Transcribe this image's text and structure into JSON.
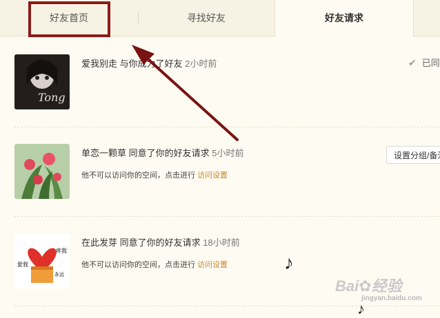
{
  "tabs": {
    "home": "好友首页",
    "find": "寻找好友",
    "requests": "好友请求"
  },
  "requests": [
    {
      "name": "爱我别走",
      "action": "与你成为了好友",
      "time": "2小时前",
      "status": "已同"
    },
    {
      "name": "单恋一颗草",
      "action": "同意了你的好友请求",
      "time": "5小时前",
      "note": "他不可以访问你的空间，点击进行",
      "link": "访问设置",
      "button": "设置分组/备注"
    },
    {
      "name": "在此发芽",
      "action": "同意了你的好友请求",
      "time": "18小时前",
      "note": "他不可以访问你的空间，点击进行",
      "link": "访问设置"
    }
  ],
  "watermark": {
    "brand": "Bai",
    "brand2": "经验",
    "url": "jingyan.baidu.com"
  },
  "colors": {
    "highlight": "#8b1a1a",
    "link": "#c8892e",
    "background": "#fdfbf2"
  }
}
